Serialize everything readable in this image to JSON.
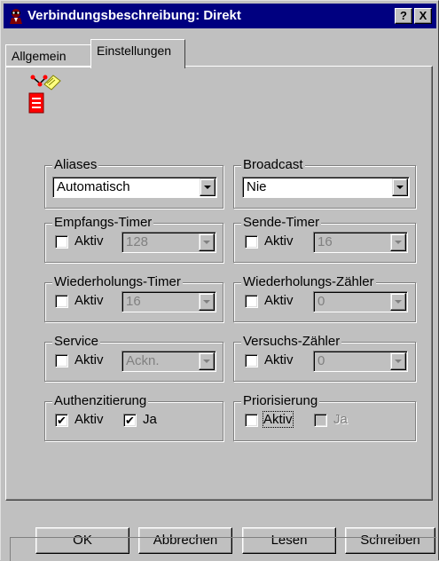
{
  "window": {
    "title": "Verbindungsbeschreibung: Direkt",
    "icon": "connection-spy-icon",
    "help_label": "?",
    "close_label": "X"
  },
  "tabs": [
    {
      "label": "Allgemein",
      "selected": false
    },
    {
      "label": "Einstellungen",
      "selected": true
    }
  ],
  "panel": {
    "icon": "connection-settings-icon"
  },
  "groups": {
    "aliases": {
      "label": "Aliases",
      "value": "Automatisch"
    },
    "broadcast": {
      "label": "Broadcast",
      "value": "Nie"
    },
    "empfangs_timer": {
      "label": "Empfangs-Timer",
      "check_label": "Aktiv",
      "checked": false,
      "value": "128"
    },
    "sende_timer": {
      "label": "Sende-Timer",
      "check_label": "Aktiv",
      "checked": false,
      "value": "16"
    },
    "wiederholungs_timer": {
      "label": "Wiederholungs-Timer",
      "check_label": "Aktiv",
      "checked": false,
      "value": "16"
    },
    "wiederholungs_zaehler": {
      "label": "Wiederholungs-Zähler",
      "check_label": "Aktiv",
      "checked": false,
      "value": "0"
    },
    "service": {
      "label": "Service",
      "check_label": "Aktiv",
      "checked": false,
      "value": "Ackn."
    },
    "versuchs_zaehler": {
      "label": "Versuchs-Zähler",
      "check_label": "Aktiv",
      "checked": false,
      "value": "0"
    },
    "authenzitierung": {
      "label": "Authenzitierung",
      "check_label": "Aktiv",
      "checked": true,
      "ja_label": "Ja",
      "ja_checked": true
    },
    "priorisierung": {
      "label": "Priorisierung",
      "check_label": "Aktiv",
      "checked": false,
      "ja_label": "Ja",
      "ja_checked": false,
      "ja_enabled": false
    }
  },
  "buttons": {
    "ok": "OK",
    "abbrechen": "Abbrechen",
    "lesen": "Lesen",
    "schreiben": "Schreiben"
  },
  "check_mark": "✔"
}
